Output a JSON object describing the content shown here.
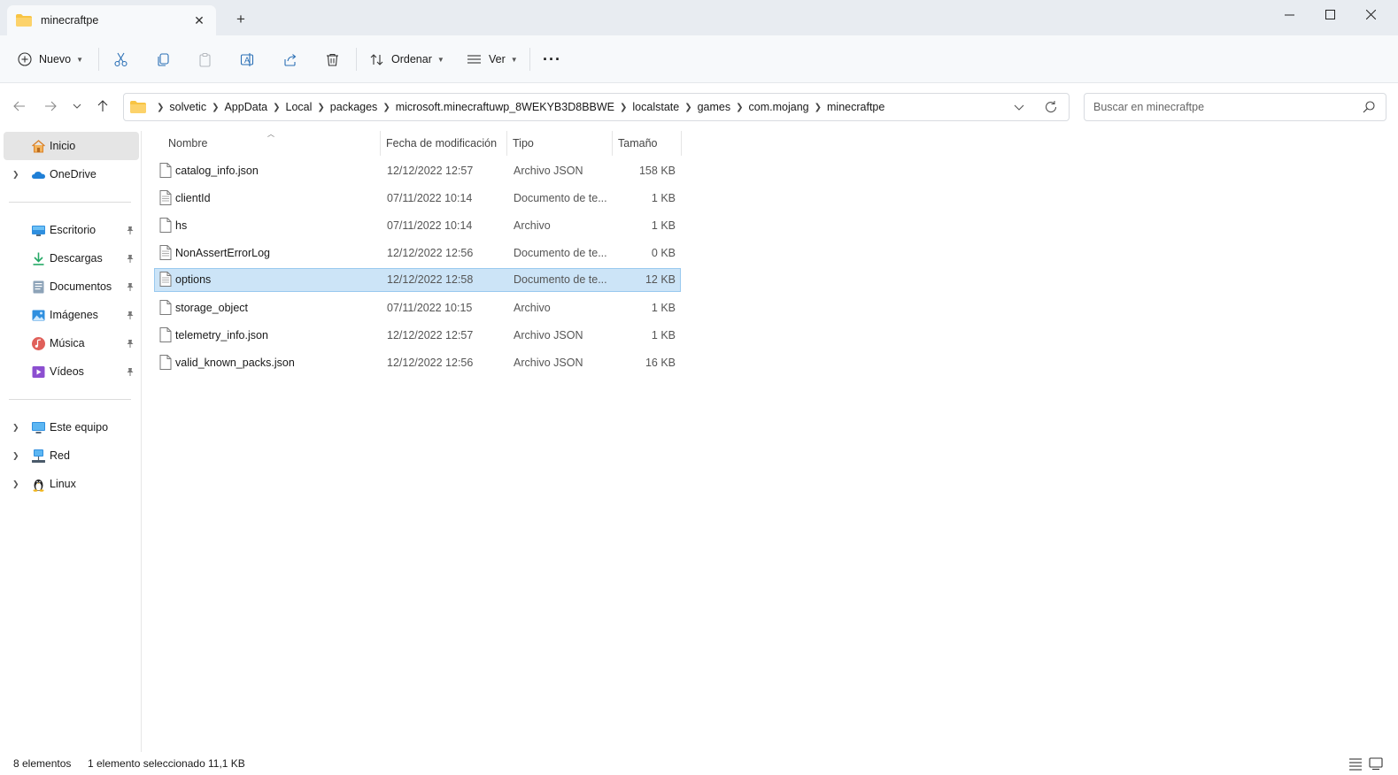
{
  "window": {
    "tab_title": "minecraftpe",
    "tab_close": "✕",
    "new_tab": "+"
  },
  "toolbar": {
    "new_label": "Nuevo",
    "sort_label": "Ordenar",
    "view_label": "Ver",
    "more_label": "···"
  },
  "address": {
    "breadcrumbs": [
      "solvetic",
      "AppData",
      "Local",
      "packages",
      "microsoft.minecraftuwp_8WEKYB3D8BBWE",
      "localstate",
      "games",
      "com.mojang",
      "minecraftpe"
    ]
  },
  "search": {
    "placeholder": "Buscar en minecraftpe"
  },
  "sidebar": {
    "items": [
      {
        "label": "Inicio"
      },
      {
        "label": "OneDrive"
      },
      {
        "label": "Escritorio"
      },
      {
        "label": "Descargas"
      },
      {
        "label": "Documentos"
      },
      {
        "label": "Imágenes"
      },
      {
        "label": "Música"
      },
      {
        "label": "Vídeos"
      },
      {
        "label": "Este equipo"
      },
      {
        "label": "Red"
      },
      {
        "label": "Linux"
      }
    ]
  },
  "filelist": {
    "columns": [
      "Nombre",
      "Fecha de modificación",
      "Tipo",
      "Tamaño"
    ],
    "rows": [
      {
        "name": "catalog_info.json",
        "date": "12/12/2022 12:57",
        "type": "Archivo JSON",
        "size": "158 KB"
      },
      {
        "name": "clientId",
        "date": "07/11/2022 10:14",
        "type": "Documento de te...",
        "size": "1 KB"
      },
      {
        "name": "hs",
        "date": "07/11/2022 10:14",
        "type": "Archivo",
        "size": "1 KB"
      },
      {
        "name": "NonAssertErrorLog",
        "date": "12/12/2022 12:56",
        "type": "Documento de te...",
        "size": "0 KB"
      },
      {
        "name": "options",
        "date": "12/12/2022 12:58",
        "type": "Documento de te...",
        "size": "12 KB"
      },
      {
        "name": "storage_object",
        "date": "07/11/2022 10:15",
        "type": "Archivo",
        "size": "1 KB"
      },
      {
        "name": "telemetry_info.json",
        "date": "12/12/2022 12:57",
        "type": "Archivo JSON",
        "size": "1 KB"
      },
      {
        "name": "valid_known_packs.json",
        "date": "12/12/2022 12:56",
        "type": "Archivo JSON",
        "size": "16 KB"
      }
    ]
  },
  "status": {
    "count": "8 elementos",
    "selection": "1 elemento seleccionado",
    "selection_size": "11,1 KB"
  },
  "colors": {
    "accent": "#0067c0",
    "selection_bg": "#cce4f7",
    "folder": "#f8c443"
  }
}
